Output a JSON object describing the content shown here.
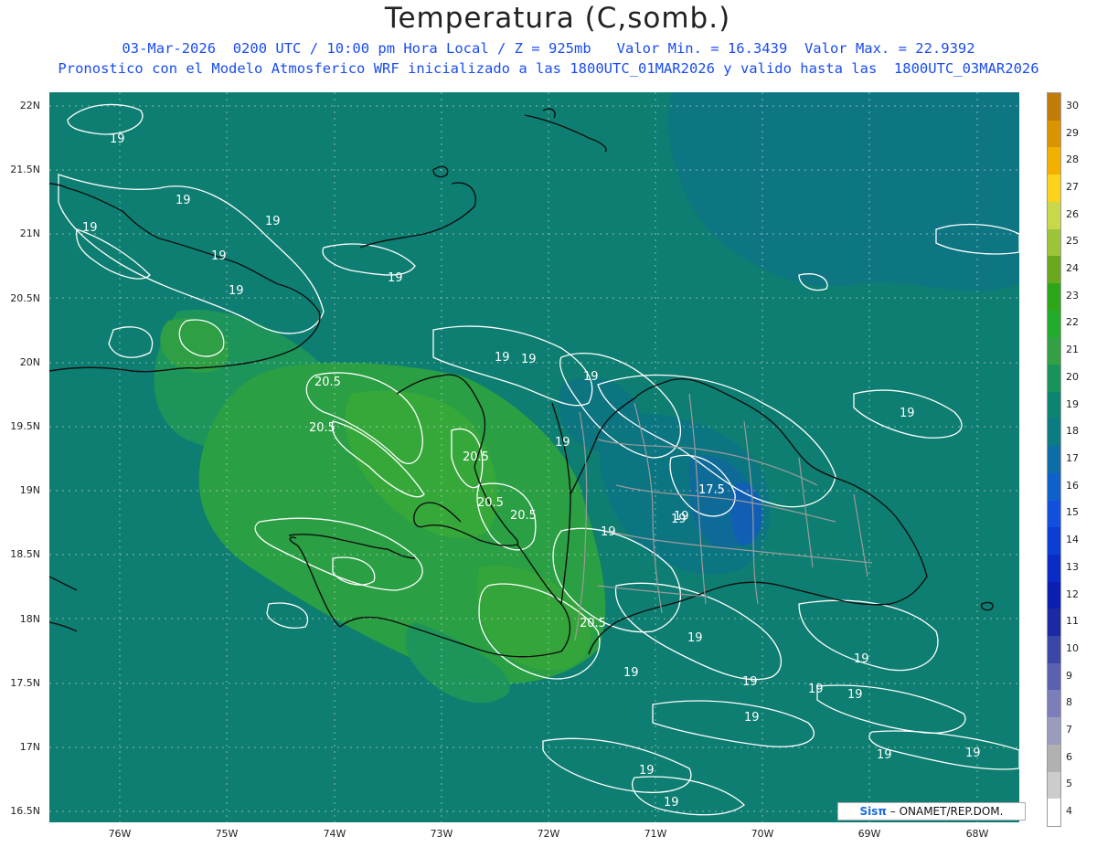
{
  "header": {
    "title": "Temperatura (C,somb.)",
    "line1": "03-Mar-2026  0200 UTC / 10:00 pm Hora Local / Z = 925mb   Valor Min. = 16.3439  Valor Max. = 22.9392",
    "line2": "Pronostico con el Modelo Atmosferico WRF inicializado a las 1800UTC_01MAR2026 y valido hasta las  1800UTC_03MAR2026"
  },
  "axes": {
    "lat_labels": [
      "22N",
      "21.5N",
      "21N",
      "20.5N",
      "20N",
      "19.5N",
      "19N",
      "18.5N",
      "18N",
      "17.5N",
      "17N",
      "16.5N"
    ],
    "lon_labels": [
      "76W",
      "75W",
      "74W",
      "73W",
      "72W",
      "71W",
      "70W",
      "69W",
      "68W"
    ]
  },
  "legend": {
    "levels": [
      "30",
      "29",
      "28",
      "27",
      "26",
      "25",
      "24",
      "23",
      "22",
      "21",
      "20",
      "19",
      "18",
      "17",
      "16",
      "15",
      "14",
      "13",
      "12",
      "11",
      "10",
      "9",
      "8",
      "7",
      "6",
      "5",
      "4"
    ],
    "colors": [
      "#c07c06",
      "#dc9300",
      "#f4b000",
      "#ffd21a",
      "#c9d84a",
      "#9cc43a",
      "#6aa81e",
      "#2ea61a",
      "#22ac2c",
      "#34a045",
      "#18935a",
      "#0b8571",
      "#0b7c83",
      "#0e6da7",
      "#1060cc",
      "#1050dc",
      "#0b3ed4",
      "#0a2cc6",
      "#0a1eb2",
      "#1b2aa2",
      "#3a46a8",
      "#5a62b0",
      "#7b7eba",
      "#9b9bbe",
      "#b1b1b1",
      "#cccccc",
      "#ffffff"
    ]
  },
  "contours": {
    "labels": [
      "19",
      "19",
      "19",
      "19",
      "19",
      "19",
      "19",
      "19",
      "19",
      "19",
      "20.5",
      "20.5",
      "20.5",
      "20.5",
      "20.5",
      "19",
      "19",
      "19",
      "17.5",
      "19",
      "19",
      "20.5",
      "19",
      "19",
      "19",
      "19",
      "19",
      "19",
      "19",
      "19",
      "19",
      "19",
      "19"
    ]
  },
  "credit": {
    "brand": "Sisπ",
    "text": "– ONAMET/REP.DOM."
  }
}
